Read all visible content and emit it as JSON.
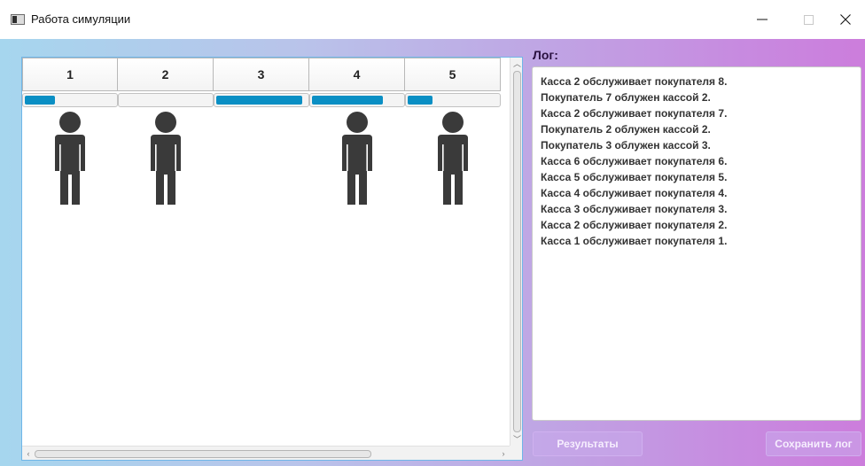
{
  "window": {
    "title": "Работа симуляции",
    "controls": {
      "minimize": "—",
      "maximize": "□",
      "close": "✕"
    }
  },
  "queue": {
    "columns": [
      {
        "label": "1",
        "progress": 0.33,
        "has_person": true
      },
      {
        "label": "2",
        "progress": 0.0,
        "has_person": true
      },
      {
        "label": "3",
        "progress": 0.95,
        "has_person": false
      },
      {
        "label": "4",
        "progress": 0.78,
        "has_person": true
      },
      {
        "label": "5",
        "progress": 0.27,
        "has_person": true
      }
    ],
    "person_icon": "person-icon",
    "accent_color": "#0a8fc4",
    "person_color": "#3a3a3a"
  },
  "log": {
    "label": "Лог:",
    "lines": [
      "Касса 2 обслуживает покупателя 8.",
      "Покупатель 7 облужен кассой 2.",
      "Касса 2 обслуживает покупателя 7.",
      "Покупатель 2 облужен кассой 2.",
      "Покупатель 3 облужен кассой 3.",
      "Касса 6 обслуживает покупателя 6.",
      "Касса 5 обслуживает покупателя 5.",
      "Касса 4 обслуживает покупателя 4.",
      "Касса 3 обслуживает покупателя 3.",
      "Касса 2 обслуживает покупателя 2.",
      "Касса 1 обслуживает покупателя 1."
    ]
  },
  "buttons": {
    "results": "Результаты",
    "save_log": "Сохранить лог"
  }
}
